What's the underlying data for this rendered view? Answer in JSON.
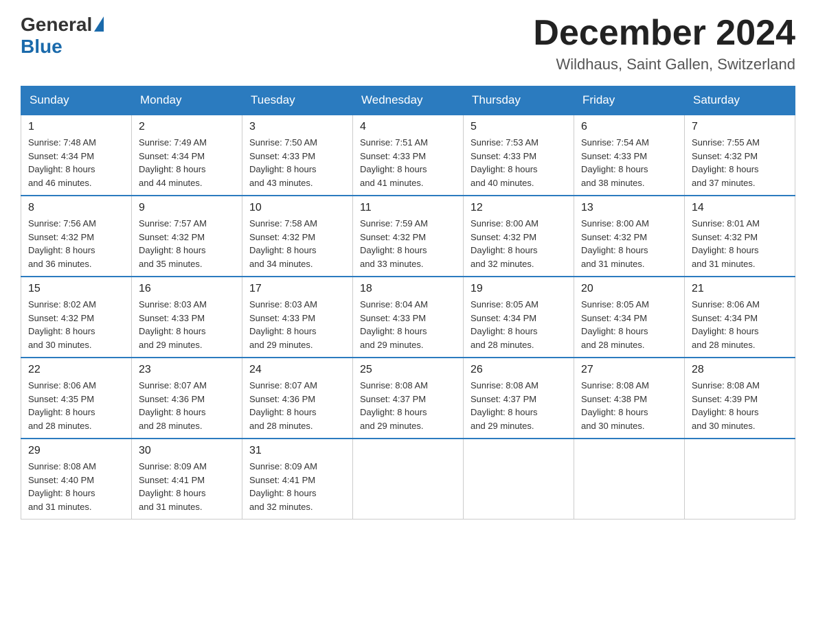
{
  "logo": {
    "general": "General",
    "blue": "Blue"
  },
  "title": "December 2024",
  "location": "Wildhaus, Saint Gallen, Switzerland",
  "weekdays": [
    "Sunday",
    "Monday",
    "Tuesday",
    "Wednesday",
    "Thursday",
    "Friday",
    "Saturday"
  ],
  "weeks": [
    [
      {
        "day": "1",
        "sunrise": "7:48 AM",
        "sunset": "4:34 PM",
        "daylight": "8 hours and 46 minutes."
      },
      {
        "day": "2",
        "sunrise": "7:49 AM",
        "sunset": "4:34 PM",
        "daylight": "8 hours and 44 minutes."
      },
      {
        "day": "3",
        "sunrise": "7:50 AM",
        "sunset": "4:33 PM",
        "daylight": "8 hours and 43 minutes."
      },
      {
        "day": "4",
        "sunrise": "7:51 AM",
        "sunset": "4:33 PM",
        "daylight": "8 hours and 41 minutes."
      },
      {
        "day": "5",
        "sunrise": "7:53 AM",
        "sunset": "4:33 PM",
        "daylight": "8 hours and 40 minutes."
      },
      {
        "day": "6",
        "sunrise": "7:54 AM",
        "sunset": "4:33 PM",
        "daylight": "8 hours and 38 minutes."
      },
      {
        "day": "7",
        "sunrise": "7:55 AM",
        "sunset": "4:32 PM",
        "daylight": "8 hours and 37 minutes."
      }
    ],
    [
      {
        "day": "8",
        "sunrise": "7:56 AM",
        "sunset": "4:32 PM",
        "daylight": "8 hours and 36 minutes."
      },
      {
        "day": "9",
        "sunrise": "7:57 AM",
        "sunset": "4:32 PM",
        "daylight": "8 hours and 35 minutes."
      },
      {
        "day": "10",
        "sunrise": "7:58 AM",
        "sunset": "4:32 PM",
        "daylight": "8 hours and 34 minutes."
      },
      {
        "day": "11",
        "sunrise": "7:59 AM",
        "sunset": "4:32 PM",
        "daylight": "8 hours and 33 minutes."
      },
      {
        "day": "12",
        "sunrise": "8:00 AM",
        "sunset": "4:32 PM",
        "daylight": "8 hours and 32 minutes."
      },
      {
        "day": "13",
        "sunrise": "8:00 AM",
        "sunset": "4:32 PM",
        "daylight": "8 hours and 31 minutes."
      },
      {
        "day": "14",
        "sunrise": "8:01 AM",
        "sunset": "4:32 PM",
        "daylight": "8 hours and 31 minutes."
      }
    ],
    [
      {
        "day": "15",
        "sunrise": "8:02 AM",
        "sunset": "4:32 PM",
        "daylight": "8 hours and 30 minutes."
      },
      {
        "day": "16",
        "sunrise": "8:03 AM",
        "sunset": "4:33 PM",
        "daylight": "8 hours and 29 minutes."
      },
      {
        "day": "17",
        "sunrise": "8:03 AM",
        "sunset": "4:33 PM",
        "daylight": "8 hours and 29 minutes."
      },
      {
        "day": "18",
        "sunrise": "8:04 AM",
        "sunset": "4:33 PM",
        "daylight": "8 hours and 29 minutes."
      },
      {
        "day": "19",
        "sunrise": "8:05 AM",
        "sunset": "4:34 PM",
        "daylight": "8 hours and 28 minutes."
      },
      {
        "day": "20",
        "sunrise": "8:05 AM",
        "sunset": "4:34 PM",
        "daylight": "8 hours and 28 minutes."
      },
      {
        "day": "21",
        "sunrise": "8:06 AM",
        "sunset": "4:34 PM",
        "daylight": "8 hours and 28 minutes."
      }
    ],
    [
      {
        "day": "22",
        "sunrise": "8:06 AM",
        "sunset": "4:35 PM",
        "daylight": "8 hours and 28 minutes."
      },
      {
        "day": "23",
        "sunrise": "8:07 AM",
        "sunset": "4:36 PM",
        "daylight": "8 hours and 28 minutes."
      },
      {
        "day": "24",
        "sunrise": "8:07 AM",
        "sunset": "4:36 PM",
        "daylight": "8 hours and 28 minutes."
      },
      {
        "day": "25",
        "sunrise": "8:08 AM",
        "sunset": "4:37 PM",
        "daylight": "8 hours and 29 minutes."
      },
      {
        "day": "26",
        "sunrise": "8:08 AM",
        "sunset": "4:37 PM",
        "daylight": "8 hours and 29 minutes."
      },
      {
        "day": "27",
        "sunrise": "8:08 AM",
        "sunset": "4:38 PM",
        "daylight": "8 hours and 30 minutes."
      },
      {
        "day": "28",
        "sunrise": "8:08 AM",
        "sunset": "4:39 PM",
        "daylight": "8 hours and 30 minutes."
      }
    ],
    [
      {
        "day": "29",
        "sunrise": "8:08 AM",
        "sunset": "4:40 PM",
        "daylight": "8 hours and 31 minutes."
      },
      {
        "day": "30",
        "sunrise": "8:09 AM",
        "sunset": "4:41 PM",
        "daylight": "8 hours and 31 minutes."
      },
      {
        "day": "31",
        "sunrise": "8:09 AM",
        "sunset": "4:41 PM",
        "daylight": "8 hours and 32 minutes."
      },
      null,
      null,
      null,
      null
    ]
  ],
  "labels": {
    "sunrise": "Sunrise: ",
    "sunset": "Sunset: ",
    "daylight": "Daylight: "
  }
}
